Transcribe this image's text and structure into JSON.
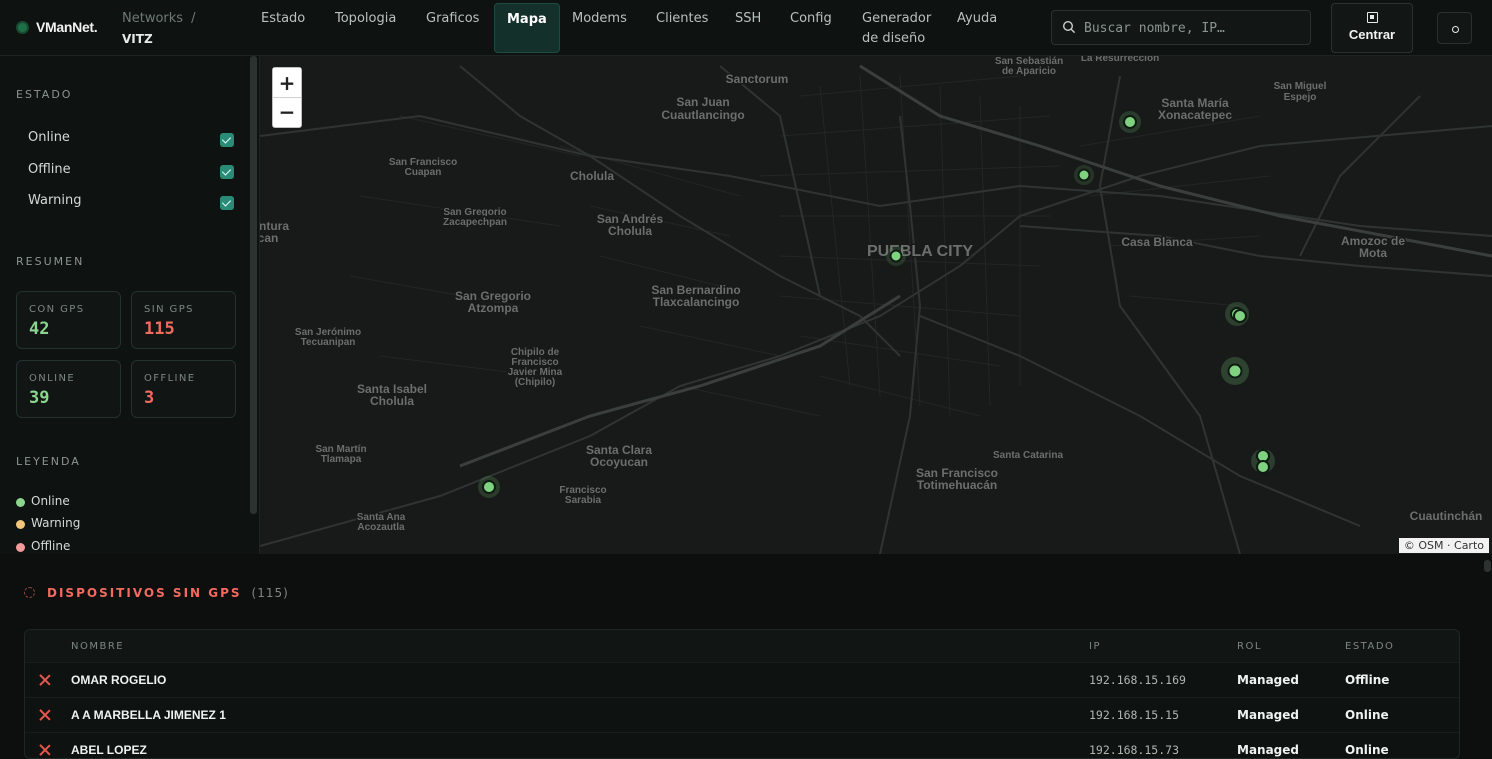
{
  "brand": {
    "name": "VManNet."
  },
  "breadcrumb": {
    "root": "Networks",
    "separator": "/",
    "current": "VITZ"
  },
  "nav": {
    "estado": "Estado",
    "topologia": "Topologia",
    "graficos": "Graficos",
    "mapa": "Mapa",
    "modems": "Modems",
    "clientes": "Clientes",
    "ssh": "SSH",
    "config": "Config",
    "generador_1": "Generador",
    "generador_2": "de diseño",
    "ayuda": "Ayuda",
    "active": "Mapa"
  },
  "search": {
    "placeholder": "Buscar nombre, IP…",
    "value": ""
  },
  "toolbar": {
    "center_label": "Centrar"
  },
  "sidebar": {
    "estado_title": "ESTADO",
    "filters": [
      {
        "label": "Online",
        "checked": true
      },
      {
        "label": "Offline",
        "checked": true
      },
      {
        "label": "Warning",
        "checked": true
      }
    ],
    "resumen_title": "RESUMEN",
    "stats": {
      "con_gps": {
        "label": "CON GPS",
        "value": "42"
      },
      "sin_gps": {
        "label": "SIN GPS",
        "value": "115"
      },
      "online": {
        "label": "ONLINE",
        "value": "39"
      },
      "offline": {
        "label": "OFFLINE",
        "value": "3"
      }
    },
    "leyenda_title": "LEYENDA",
    "legend": [
      {
        "label": "Online",
        "color": "#8cd58f"
      },
      {
        "label": "Warning",
        "color": "#f3c57a"
      },
      {
        "label": "Offline",
        "color": "#f19a9a"
      }
    ]
  },
  "map": {
    "zoom_in": "+",
    "zoom_out": "−",
    "attribution": "© OSM · Carto",
    "marker_color": "#7fd27f",
    "labels": {
      "puebla": "PUEBLA CITY",
      "sanctorum": "Sanctorum",
      "sanjuan1": "San Juan",
      "sanjuan2": "Cuautlancingo",
      "sanfrancisco1": "San Francisco",
      "sanfrancisco2": "Cuapan",
      "cholula": "Cholula",
      "sangregorio_z1": "San Gregorio",
      "sangregorio_z2": "Zacapechpan",
      "sanandres1": "San Andrés",
      "sanandres2": "Cholula",
      "ventura1": "ntura",
      "ventura2": "can",
      "sanbernardino1": "San Bernardino",
      "sanbernardino2": "Tlaxcalancingo",
      "sangregorio_a1": "San Gregorio",
      "sangregorio_a2": "Atzompa",
      "sanjeronimo1": "San Jerónimo",
      "sanjeronimo2": "Tecuanipan",
      "chipilo1": "Chipilo de",
      "chipilo2": "Francisco",
      "chipilo3": "Javier Mina",
      "chipilo4": "(Chipilo)",
      "santaisabel1": "Santa Isabel",
      "santaisabel2": "Cholula",
      "sanmartin1": "San Martín",
      "sanmartin2": "Tlamapa",
      "santaclara1": "Santa Clara",
      "santaclara2": "Ocoyucan",
      "franciscosarabia1": "Francisco",
      "franciscosarabia2": "Sarabia",
      "santaana1": "Santa Ana",
      "santaana2": "Acozautla",
      "sanfranciscotot1": "San Francisco",
      "sanfranciscotot2": "Totimehuacán",
      "santacatarina": "Santa Catarina",
      "casablanca": "Casa Blanca",
      "santamaria1": "Santa María",
      "santamaria2": "Xonacatepec",
      "sanmiguel1": "San Miguel",
      "sanmiguel2": "Espejo",
      "sansebastian1": "San Sebastián",
      "sansebastian2": "de Aparicio",
      "laresurreccion": "La Resurrección",
      "amozoc1": "Amozoc de",
      "amozoc2": "Mota",
      "cuautinchan": "Cuautinchán"
    }
  },
  "no_gps": {
    "title": "DISPOSITIVOS SIN GPS",
    "count": "(115)",
    "columns": {
      "nombre": "NOMBRE",
      "ip": "IP",
      "rol": "ROL",
      "estado": "ESTADO"
    },
    "rows": [
      {
        "nombre": "OMAR ROGELIO",
        "ip": "192.168.15.169",
        "rol": "Managed",
        "estado": "Offline"
      },
      {
        "nombre": "A A MARBELLA JIMENEZ 1",
        "ip": "192.168.15.15",
        "rol": "Managed",
        "estado": "Online"
      },
      {
        "nombre": "ABEL LOPEZ",
        "ip": "192.168.15.73",
        "rol": "Managed",
        "estado": "Online"
      }
    ]
  }
}
